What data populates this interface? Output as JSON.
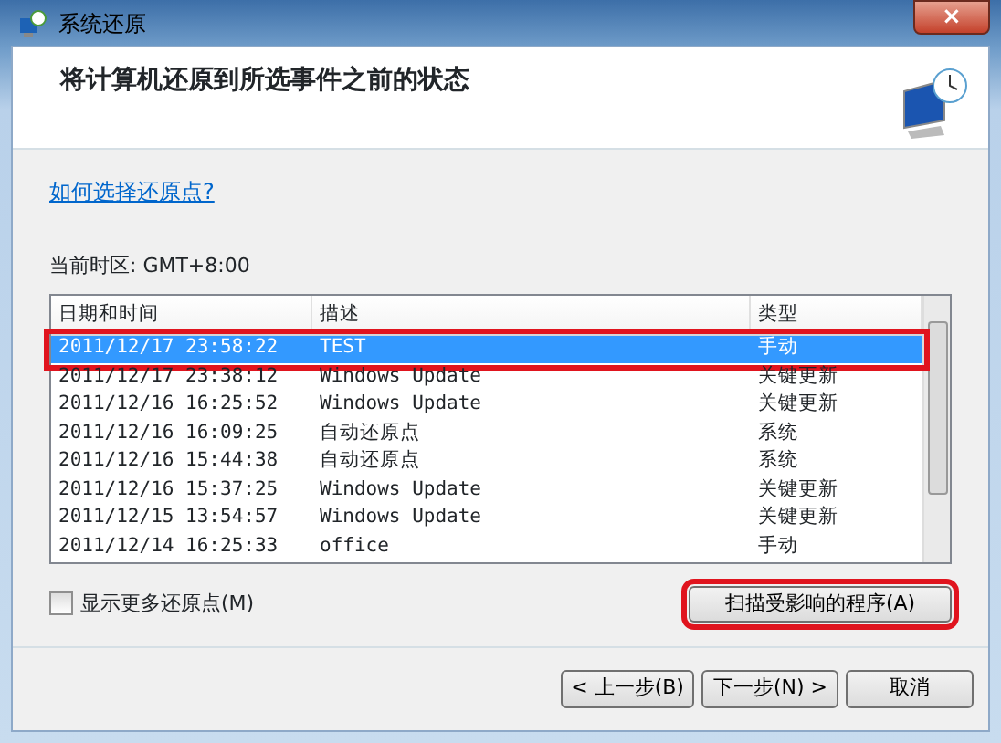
{
  "window": {
    "title": "系统还原",
    "close": "×"
  },
  "header": {
    "heading": "将计算机还原到所选事件之前的状态"
  },
  "help_link": "如何选择还原点?",
  "timezone": "当前时区: GMT+8:00",
  "table": {
    "columns": [
      "日期和时间",
      "描述",
      "类型"
    ],
    "rows": [
      {
        "cells": [
          "2011/12/17 23:58:22",
          "TEST",
          "手动"
        ],
        "selected": true,
        "annotated": true
      },
      {
        "cells": [
          "2011/12/17 23:38:12",
          "Windows Update",
          "关键更新"
        ],
        "selected": false,
        "annotated": false
      },
      {
        "cells": [
          "2011/12/16 16:25:52",
          "Windows Update",
          "关键更新"
        ],
        "selected": false,
        "annotated": false
      },
      {
        "cells": [
          "2011/12/16 16:09:25",
          "自动还原点",
          "系统"
        ],
        "selected": false,
        "annotated": false
      },
      {
        "cells": [
          "2011/12/16 15:44:38",
          "自动还原点",
          "系统"
        ],
        "selected": false,
        "annotated": false
      },
      {
        "cells": [
          "2011/12/16 15:37:25",
          "Windows Update",
          "关键更新"
        ],
        "selected": false,
        "annotated": false
      },
      {
        "cells": [
          "2011/12/15 13:54:57",
          "Windows Update",
          "关键更新"
        ],
        "selected": false,
        "annotated": false
      },
      {
        "cells": [
          "2011/12/14 16:25:33",
          "office",
          "手动"
        ],
        "selected": false,
        "annotated": false
      }
    ]
  },
  "show_more": {
    "label": "显示更多还原点(M)",
    "checked": false
  },
  "scan_button": {
    "label": "扫描受影响的程序(A)",
    "annotated": true
  },
  "buttons": [
    "< 上一步(B)",
    "下一步(N) >",
    "取消"
  ]
}
